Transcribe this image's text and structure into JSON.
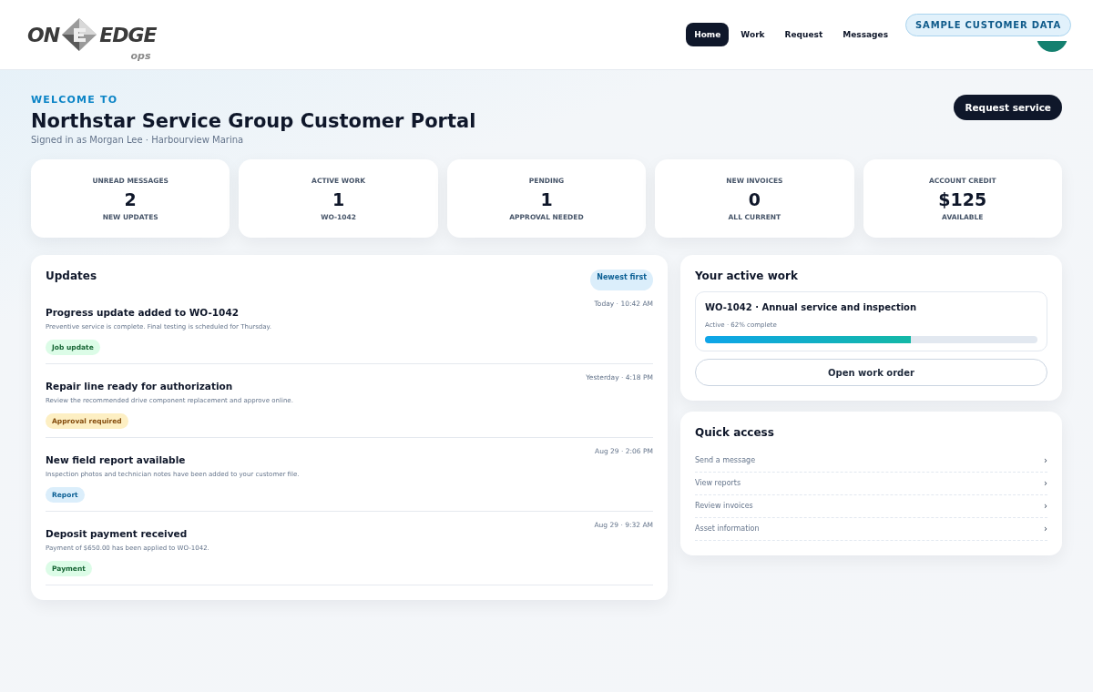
{
  "logo": {
    "left": "ON",
    "right": "EDGE",
    "sub": "ops"
  },
  "nav": [
    {
      "label": "Home",
      "selected": true
    },
    {
      "label": "Work",
      "selected": false
    },
    {
      "label": "Request",
      "selected": false
    },
    {
      "label": "Messages",
      "selected": false
    }
  ],
  "sample_badge": "SAMPLE CUSTOMER DATA",
  "hero": {
    "eyebrow": "WELCOME TO",
    "title": "Northstar Service Group Customer Portal",
    "subtitle": "Signed in as Morgan Lee · Harbourview Marina",
    "action": "Request service"
  },
  "stats": [
    {
      "label": "UNREAD MESSAGES",
      "value": "2",
      "note": "NEW UPDATES"
    },
    {
      "label": "ACTIVE WORK",
      "value": "1",
      "note": "WO-1042"
    },
    {
      "label": "PENDING",
      "value": "1",
      "note": "APPROVAL NEEDED"
    },
    {
      "label": "NEW INVOICES",
      "value": "0",
      "note": "ALL CURRENT"
    },
    {
      "label": "ACCOUNT CREDIT",
      "value": "$125",
      "note": "AVAILABLE"
    }
  ],
  "updates": {
    "title": "Updates",
    "sort": "Newest first",
    "items": [
      {
        "title": "Progress update added to WO-1042",
        "text": "Preventive service is complete. Final testing is scheduled for Thursday.",
        "time": "Today · 10:42 AM",
        "tag": {
          "label": "Job update",
          "kind": "success"
        }
      },
      {
        "title": "Repair line ready for authorization",
        "text": "Review the recommended drive component replacement and approve online.",
        "time": "Yesterday · 4:18 PM",
        "tag": {
          "label": "Approval required",
          "kind": "warning"
        }
      },
      {
        "title": "New field report available",
        "text": "Inspection photos and technician notes have been added to your customer file.",
        "time": "Aug 29 · 2:06 PM",
        "tag": {
          "label": "Report",
          "kind": "info"
        }
      },
      {
        "title": "Deposit payment received",
        "text": "Payment of $650.00 has been applied to WO-1042.",
        "time": "Aug 29 · 9:32 AM",
        "tag": {
          "label": "Payment",
          "kind": "success"
        }
      }
    ]
  },
  "active_work": {
    "title": "Your active work",
    "order": "WO-1042 · Annual service and inspection",
    "status": "Active · 62% complete",
    "level": 0.62,
    "button": "Open work order"
  },
  "quick_access": {
    "title": "Quick access",
    "items": [
      {
        "label": "Send a message",
        "arrow": "›"
      },
      {
        "label": "View reports",
        "arrow": "›"
      },
      {
        "label": "Review invoices",
        "arrow": "›"
      },
      {
        "label": "Asset information",
        "arrow": "›"
      }
    ]
  }
}
